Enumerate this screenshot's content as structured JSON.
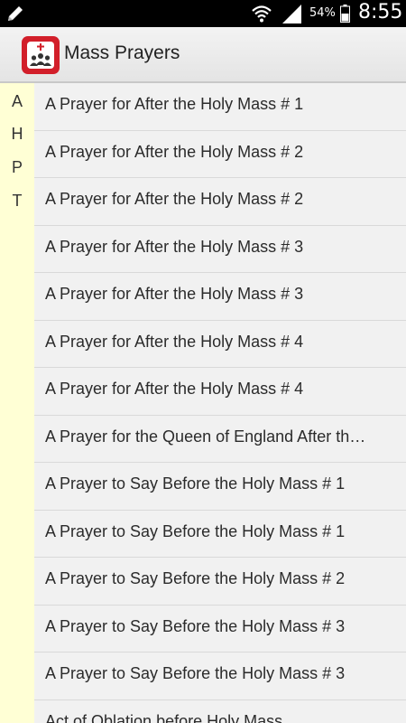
{
  "status_bar": {
    "battery": "54%",
    "time": "8:55"
  },
  "action_bar": {
    "title": "Mass Prayers"
  },
  "index": [
    "A",
    "H",
    "P",
    "T"
  ],
  "prayers": [
    "A Prayer for After the Holy Mass # 1",
    "A Prayer for After the Holy Mass # 2",
    "A Prayer for After the Holy Mass # 2",
    "A Prayer for After the Holy Mass # 3",
    "A Prayer for After the Holy Mass # 3",
    "A Prayer for After the Holy Mass # 4",
    "A Prayer for After the Holy Mass # 4",
    "A Prayer for the Queen of England After the Holy Mass",
    "A Prayer to Say Before the Holy Mass # 1",
    "A Prayer to Say Before the Holy Mass # 1",
    "A Prayer to Say Before the Holy Mass # 2",
    "A Prayer to Say Before the Holy Mass # 3",
    "A Prayer to Say Before the Holy Mass # 3",
    "Act of Oblation before Holy Mass"
  ],
  "colors": {
    "app_icon_red": "#d21f2a",
    "index_bg": "#ffffd5",
    "list_bg": "#f1f1f1"
  }
}
